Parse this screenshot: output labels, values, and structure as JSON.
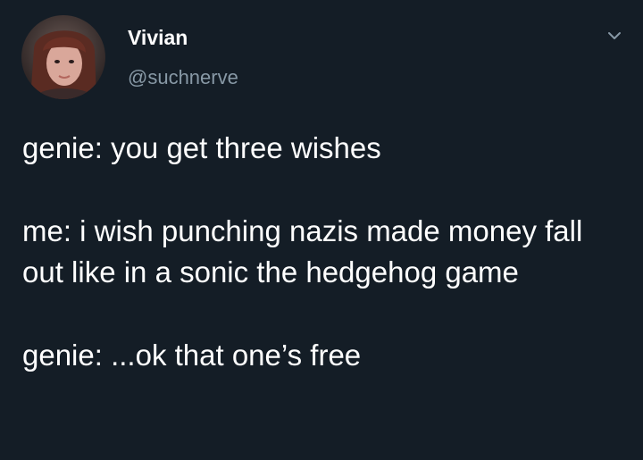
{
  "tweet": {
    "author": {
      "name": "Vivian",
      "handle": "@suchnerve",
      "avatar_icon": "user-avatar"
    },
    "menu_icon": "chevron-down-icon",
    "paragraphs": [
      "genie: you get three wishes",
      "me: i wish punching nazis made money fall out like in a sonic the hedgehog game",
      "genie: ...ok that one’s free"
    ]
  },
  "colors": {
    "background": "#141d26",
    "text": "#ffffff",
    "secondary_text": "#8899a6"
  }
}
